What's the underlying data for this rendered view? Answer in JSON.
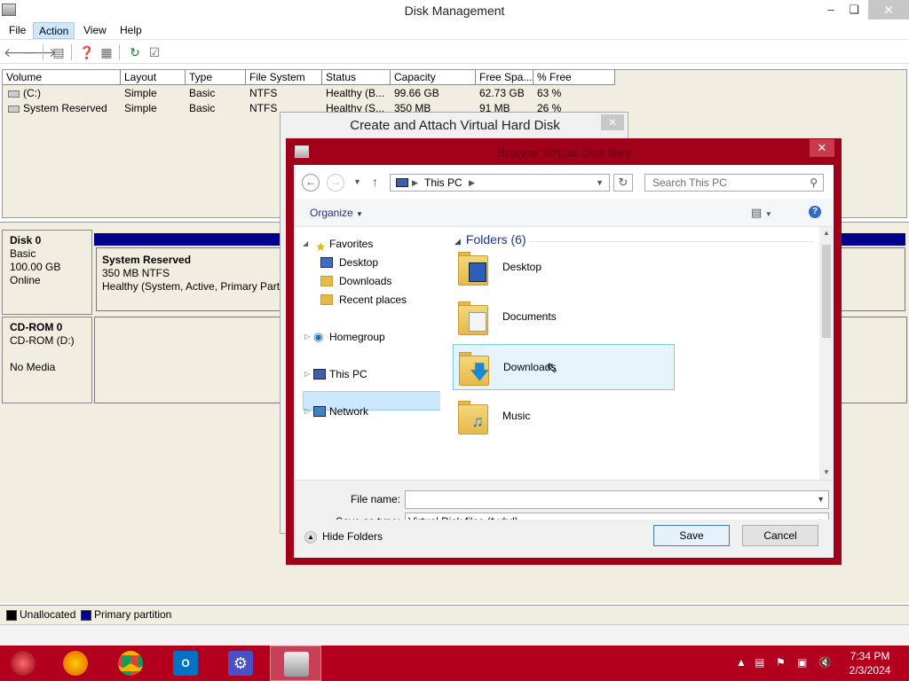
{
  "dm": {
    "title": "Disk Management",
    "menu": [
      "File",
      "Action",
      "View",
      "Help"
    ],
    "columns": [
      "Volume",
      "Layout",
      "Type",
      "File System",
      "Status",
      "Capacity",
      "Free Spa...",
      "% Free"
    ],
    "volumes": [
      {
        "volume": "(C:)",
        "layout": "Simple",
        "type": "Basic",
        "fs": "NTFS",
        "status": "Healthy (B...",
        "capacity": "99.66 GB",
        "free": "62.73 GB",
        "pct": "63 %"
      },
      {
        "volume": "System Reserved",
        "layout": "Simple",
        "type": "Basic",
        "fs": "NTFS",
        "status": "Healthy (S...",
        "capacity": "350 MB",
        "free": "91 MB",
        "pct": "26 %"
      }
    ],
    "disk0": {
      "name": "Disk 0",
      "type": "Basic",
      "size": "100.00 GB",
      "state": "Online"
    },
    "partition": {
      "name": "System Reserved",
      "detail": "350 MB NTFS",
      "status": "Healthy (System, Active, Primary Partit"
    },
    "cdrom": {
      "name": "CD-ROM 0",
      "drive": "CD-ROM (D:)",
      "media": "No Media"
    },
    "legend": {
      "unallocated": "Unallocated",
      "primary": "Primary partition"
    }
  },
  "vhd_dialog": {
    "title": "Create and Attach Virtual Hard Disk"
  },
  "browse": {
    "title": "Browse Virtual Disk files",
    "address": "This PC",
    "search_placeholder": "Search This PC",
    "organize": "Organize",
    "nav": {
      "favorites": "Favorites",
      "desktop": "Desktop",
      "downloads": "Downloads",
      "recent": "Recent places",
      "homegroup": "Homegroup",
      "thispc": "This PC",
      "network": "Network"
    },
    "section": "Folders (6)",
    "folders": [
      "Desktop",
      "Documents",
      "Downloads",
      "Music"
    ],
    "file_name_label": "File name:",
    "file_name_value": "",
    "save_type_label": "Save as type:",
    "save_type_value": "Virtual Disk files (*.vhd)",
    "hide_folders": "Hide Folders",
    "save": "Save",
    "cancel": "Cancel"
  },
  "taskbar": {
    "time": "7:34 PM",
    "date": "2/3/2024",
    "apps": [
      "firefox-icon",
      "chrome-icon",
      "outlook-icon",
      "settings-icon",
      "disk-management-icon"
    ]
  },
  "colors": {
    "accent": "#b4001f",
    "selection": "#cce8ff",
    "primary_partition": "#00008b"
  }
}
